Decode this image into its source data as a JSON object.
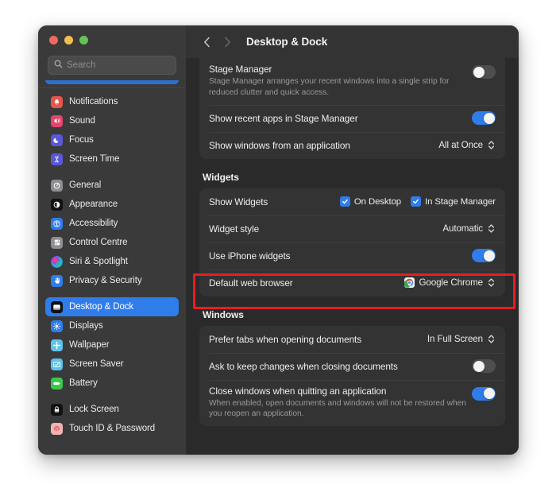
{
  "window": {
    "traffic_lights": [
      "close",
      "minimize",
      "zoom"
    ],
    "colors": {
      "accent": "#2f7ceb",
      "highlight_rect": "#e81d23",
      "window_bg": "#2d2d2d",
      "sidebar_bg": "#3a3a3a",
      "card_bg": "#333333"
    }
  },
  "sidebar": {
    "search": {
      "value": "",
      "placeholder": "Search"
    },
    "groups": [
      {
        "items": [
          {
            "label": "Notifications",
            "icon": "notifications-icon"
          },
          {
            "label": "Sound",
            "icon": "sound-icon"
          },
          {
            "label": "Focus",
            "icon": "focus-icon"
          },
          {
            "label": "Screen Time",
            "icon": "screen-time-icon"
          }
        ]
      },
      {
        "items": [
          {
            "label": "General",
            "icon": "general-icon"
          },
          {
            "label": "Appearance",
            "icon": "appearance-icon"
          },
          {
            "label": "Accessibility",
            "icon": "accessibility-icon"
          },
          {
            "label": "Control Centre",
            "icon": "control-centre-icon"
          },
          {
            "label": "Siri & Spotlight",
            "icon": "siri-icon"
          },
          {
            "label": "Privacy & Security",
            "icon": "privacy-icon"
          }
        ]
      },
      {
        "items": [
          {
            "label": "Desktop & Dock",
            "icon": "desktop-dock-icon",
            "selected": true
          },
          {
            "label": "Displays",
            "icon": "displays-icon"
          },
          {
            "label": "Wallpaper",
            "icon": "wallpaper-icon"
          },
          {
            "label": "Screen Saver",
            "icon": "screen-saver-icon"
          },
          {
            "label": "Battery",
            "icon": "battery-icon"
          }
        ]
      },
      {
        "items": [
          {
            "label": "Lock Screen",
            "icon": "lock-screen-icon"
          },
          {
            "label": "Touch ID & Password",
            "icon": "touch-id-icon"
          }
        ]
      }
    ]
  },
  "header": {
    "back": "back-chevron",
    "forward": "forward-chevron",
    "title": "Desktop & Dock"
  },
  "main": {
    "stage_manager": {
      "label": "Stage Manager",
      "description": "Stage Manager arranges your recent windows into a single strip for reduced clutter and quick access.",
      "toggle": "off"
    },
    "show_recent_apps": {
      "label": "Show recent apps in Stage Manager",
      "toggle": "on"
    },
    "show_windows": {
      "label": "Show windows from an application",
      "value": "All at Once"
    },
    "widgets_section": {
      "title": "Widgets",
      "show_widgets": {
        "label": "Show Widgets",
        "options": [
          {
            "label": "On Desktop",
            "checked": true
          },
          {
            "label": "In Stage Manager",
            "checked": true
          }
        ]
      },
      "widget_style": {
        "label": "Widget style",
        "value": "Automatic"
      },
      "use_iphone_widgets": {
        "label": "Use iPhone widgets",
        "toggle": "on"
      },
      "default_web_browser": {
        "label": "Default web browser",
        "value": "Google Chrome",
        "icon": "chrome-icon",
        "highlighted": true
      }
    },
    "windows_section": {
      "title": "Windows",
      "prefer_tabs": {
        "label": "Prefer tabs when opening documents",
        "value": "In Full Screen"
      },
      "ask_keep_changes": {
        "label": "Ask to keep changes when closing documents",
        "toggle": "off"
      },
      "close_windows": {
        "label": "Close windows when quitting an application",
        "description": "When enabled, open documents and windows will not be restored when you reopen an application.",
        "toggle": "on"
      }
    }
  }
}
